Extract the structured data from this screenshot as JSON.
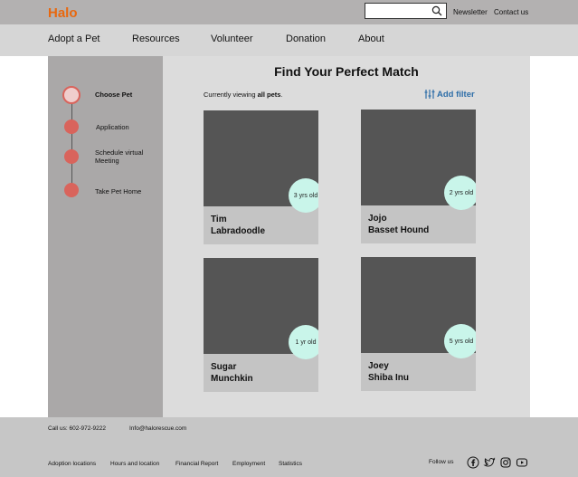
{
  "header": {
    "logo": "Halo",
    "search_placeholder": "",
    "newsletter": "Newsletter",
    "contact": "Contact us"
  },
  "nav": {
    "items": [
      "Adopt a Pet",
      "Resources",
      "Volunteer",
      "Donation",
      "About"
    ]
  },
  "steps": [
    {
      "label": "Choose Pet",
      "active": true
    },
    {
      "label": "Application",
      "active": false
    },
    {
      "label": "Schedule virtual Meeting",
      "active": false
    },
    {
      "label": "Take Pet Home",
      "active": false
    }
  ],
  "main": {
    "title": "Find Your Perfect Match",
    "viewing_prefix": "Currently viewing ",
    "viewing_value": "all pets",
    "viewing_suffix": ".",
    "add_filter": "Add filter"
  },
  "pets": [
    {
      "name": "Tim",
      "breed": "Labradoodle",
      "age": "3 yrs old"
    },
    {
      "name": "Jojo",
      "breed": "Basset Hound",
      "age": "2 yrs old"
    },
    {
      "name": "Sugar",
      "breed": "Munchkin",
      "age": "1 yr old"
    },
    {
      "name": "Joey",
      "breed": "Shiba Inu",
      "age": "5 yrs old"
    }
  ],
  "footer": {
    "phone": "Call us: 602-972-9222",
    "email": "Info@halorescue.com",
    "links": [
      "Adoption locations",
      "Hours and location",
      "Financial Report",
      "Employment",
      "Statistics"
    ],
    "follow": "Follow us",
    "social_icons": [
      "facebook-icon",
      "twitter-icon",
      "instagram-icon",
      "youtube-icon"
    ]
  },
  "colors": {
    "brand": "#e8680f",
    "step_dot": "#d9645c",
    "age_badge": "#c9f5ea",
    "filter_link": "#2e6ea8"
  }
}
